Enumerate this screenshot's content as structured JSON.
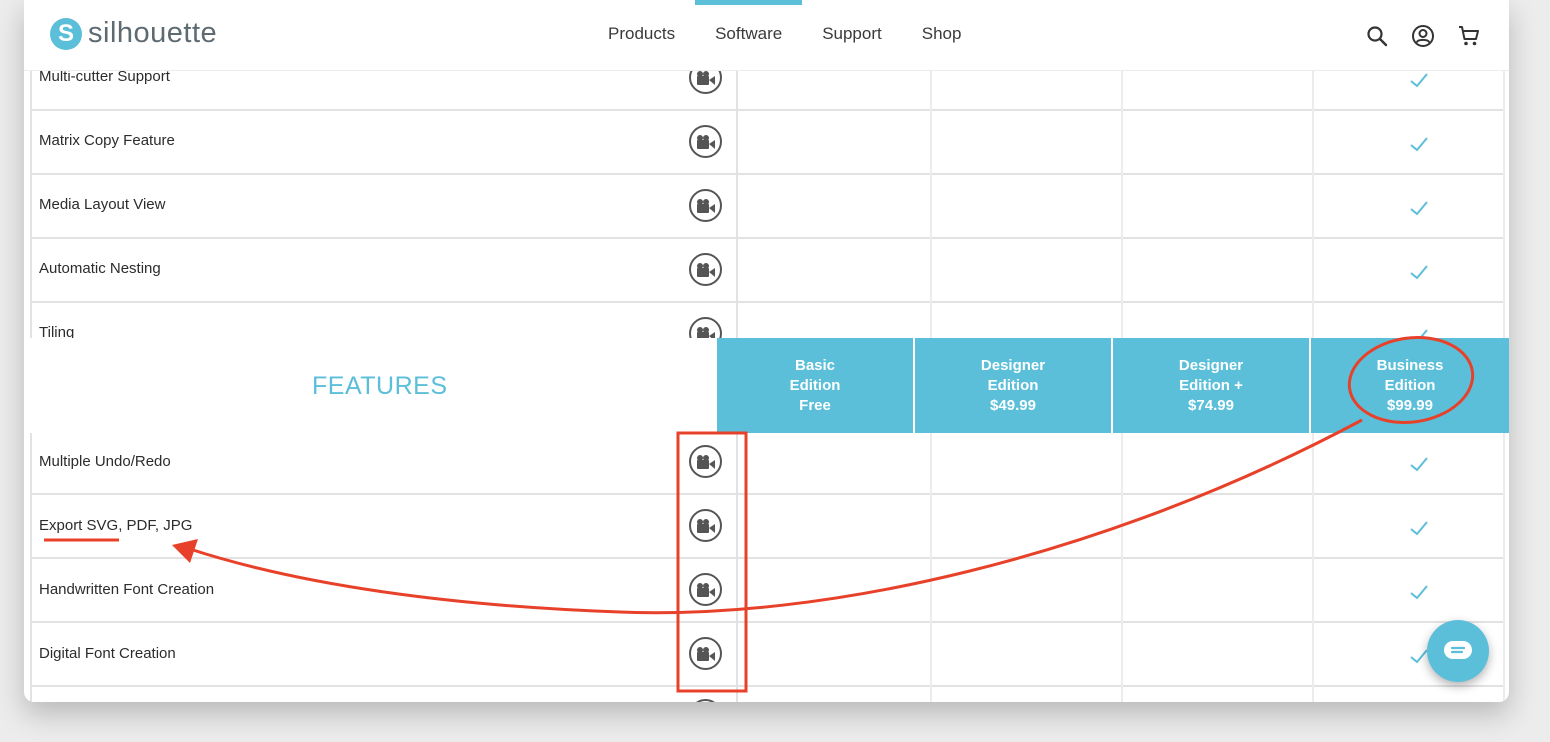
{
  "brand": {
    "name": "silhouette",
    "mark": "S",
    "color": "#5bbfd9"
  },
  "nav": [
    "Products",
    "Software",
    "Support",
    "Shop"
  ],
  "nav_active": "Software",
  "header_icons": [
    "search-icon",
    "account-icon",
    "cart-icon"
  ],
  "table": {
    "features_title": "FEATURES",
    "editions": [
      {
        "line1": "Basic",
        "line2": "Edition",
        "price": "Free"
      },
      {
        "line1": "Designer",
        "line2": "Edition",
        "price": "$49.99"
      },
      {
        "line1": "Designer",
        "line2": "Edition +",
        "price": "$74.99"
      },
      {
        "line1": "Business",
        "line2": "Edition",
        "price": "$99.99"
      }
    ],
    "rows_above": [
      {
        "label": "Multi-cutter Support",
        "check_business": true
      },
      {
        "label": "Matrix Copy Feature",
        "check_business": true
      },
      {
        "label": "Media Layout View",
        "check_business": true
      },
      {
        "label": "Automatic Nesting",
        "check_business": true
      },
      {
        "label": "Tiling",
        "check_business": true
      }
    ],
    "rows_below": [
      {
        "label": "Multiple Undo/Redo",
        "check_business": true
      },
      {
        "label": "Export SVG, PDF, JPG",
        "check_business": true
      },
      {
        "label": "Handwritten Font Creation",
        "check_business": true
      },
      {
        "label": "Digital Font Creation",
        "check_business": true
      }
    ]
  },
  "annotation_color": "#e8412a",
  "check_color": "#5bbfd9"
}
